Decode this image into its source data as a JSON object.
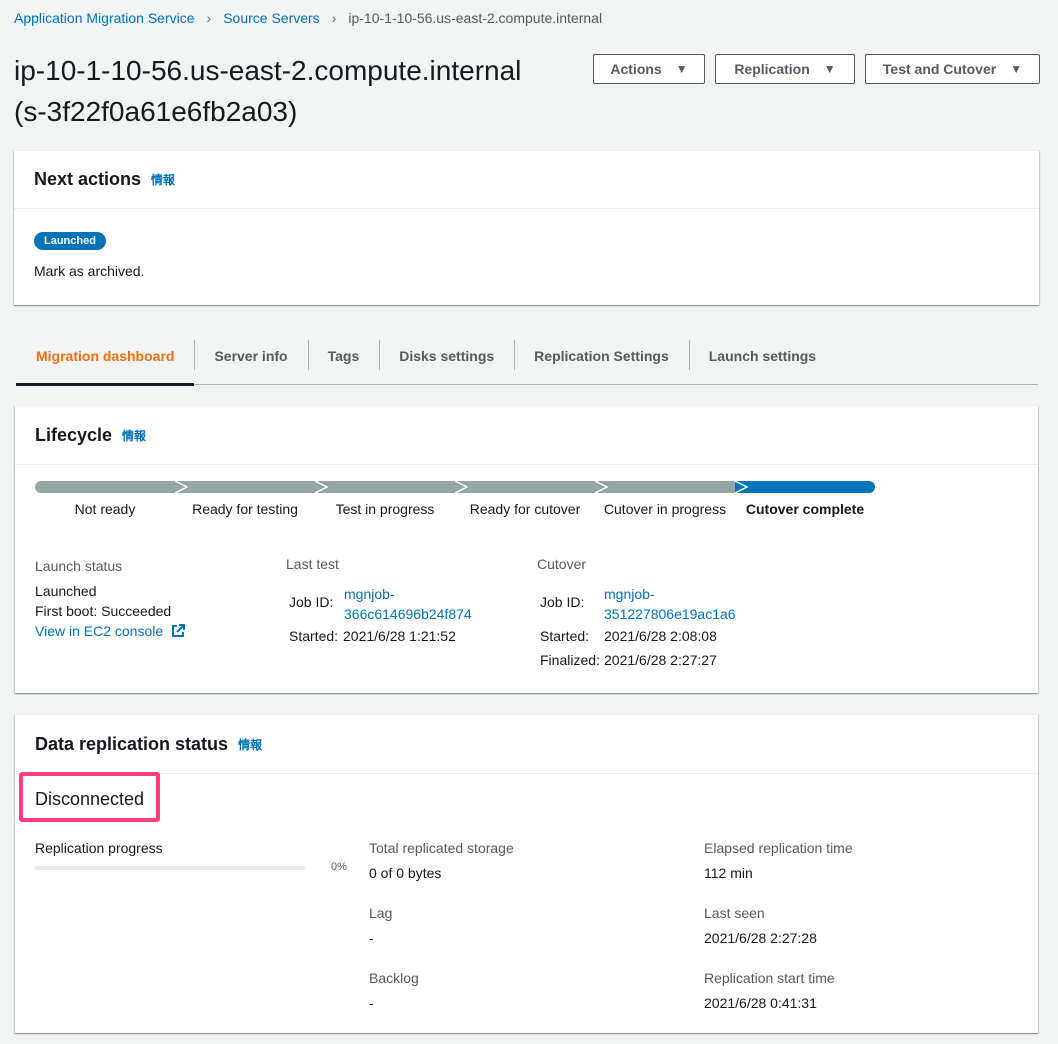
{
  "breadcrumb": {
    "items": [
      "Application Migration Service",
      "Source Servers"
    ],
    "current": "ip-10-1-10-56.us-east-2.compute.internal"
  },
  "page": {
    "title_line1": "ip-10-1-10-56.us-east-2.compute.internal",
    "title_line2": "(s-3f22f0a61e6fb2a03)"
  },
  "header_buttons": {
    "actions": "Actions",
    "replication": "Replication",
    "test_and_cutover": "Test and Cutover"
  },
  "next_actions": {
    "title": "Next actions",
    "info": "情報",
    "badge": "Launched",
    "message": "Mark as archived."
  },
  "tabs": [
    "Migration dashboard",
    "Server info",
    "Tags",
    "Disks settings",
    "Replication Settings",
    "Launch settings"
  ],
  "active_tab": "Migration dashboard",
  "lifecycle": {
    "title": "Lifecycle",
    "info": "情報",
    "steps": [
      "Not ready",
      "Ready for testing",
      "Test in progress",
      "Ready for cutover",
      "Cutover in progress",
      "Cutover complete"
    ],
    "current_step": "Cutover complete",
    "launch_status": {
      "label": "Launch status",
      "status": "Launched",
      "first_boot": "First boot: Succeeded",
      "link": "View in EC2 console"
    },
    "last_test": {
      "label": "Last test",
      "job_id_label": "Job ID:",
      "job_id_line1": "mgnjob-",
      "job_id_line2": "366c614696b24f874",
      "started_label": "Started:",
      "started": "2021/6/28 1:21:52"
    },
    "cutover": {
      "label": "Cutover",
      "job_id_label": "Job ID:",
      "job_id_line1": "mgnjob-",
      "job_id_line2": "351227806e19ac1a6",
      "started_label": "Started:",
      "started": "2021/6/28 2:08:08",
      "finalized_label": "Finalized:",
      "finalized": "2021/6/28 2:27:27"
    }
  },
  "replication": {
    "title": "Data replication status",
    "info": "情報",
    "status": "Disconnected",
    "progress_label": "Replication progress",
    "progress_value": 0,
    "progress_text": "0%",
    "total_storage_label": "Total replicated storage",
    "total_storage": "0 of 0 bytes",
    "lag_label": "Lag",
    "lag": "-",
    "backlog_label": "Backlog",
    "backlog": "-",
    "elapsed_label": "Elapsed replication time",
    "elapsed": "112 min",
    "last_seen_label": "Last seen",
    "last_seen": "2021/6/28 2:27:28",
    "start_time_label": "Replication start time",
    "start_time": "2021/6/28 0:41:31"
  },
  "colors": {
    "link": "#0073bb",
    "active_tab": "#ec7211",
    "step_done": "#95a5a6",
    "step_current": "#0073bb",
    "highlight": "#ff3d7f"
  }
}
